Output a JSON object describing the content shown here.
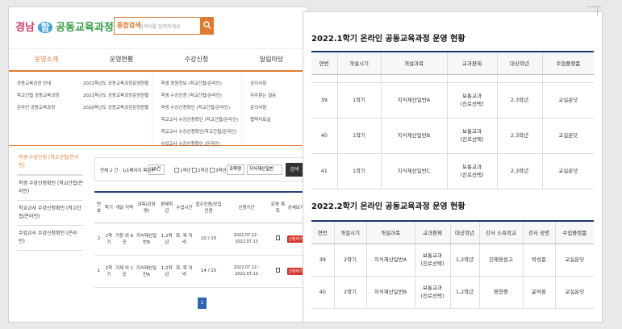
{
  "site": {
    "logo": {
      "part1": "경남",
      "part2": "함",
      "part3": "공동교육과정"
    },
    "search_tag": "통합검색",
    "search_placeholder": "검색어를 입력하세요",
    "gnb": [
      "운영소개",
      "운영현황",
      "수강신청",
      "알림마당"
    ],
    "mega": [
      [
        "공동교육과정 안내",
        "학교간협 공동교육과정",
        "온라인 공동교육과정"
      ],
      [
        "2022학년도 공동교육과정운영현황",
        "2021학년도 공동교육과정운영현황",
        "2020학년도 공동교육과정운영현황"
      ],
      [
        "학생 회원정보 (학교간협/온라인)",
        "학생 수강신청 (학교간협/온라인)",
        "학생 수강신청확인 (학교간협/온라인)",
        "학교교사 수강신청확인 (학교간협/온라인)",
        "학교교사 수강신청확인(학교간협/온라인)",
        "수업교사 수강신청확인 (온라인)"
      ],
      [
        "공지사항",
        "자주묻는 질문",
        "문의사항",
        "협력자료실"
      ]
    ],
    "lnb": [
      "학생 수강신청 (학교간협/온라인)",
      "학생 수강신청확인 (학교간협/온라인)",
      "학교교사 수강신청확인 (학교간협/온라인)",
      "수업교사 수강신청확인 (온라인)"
    ],
    "filter": {
      "count": "전체 2 건 · 1/1페이지 목록수",
      "per_page": "10건",
      "chk1": "1학년",
      "chk2": "2학년",
      "chk3": "3학년",
      "subject_select": "과목명",
      "keyword": "지식재산일반",
      "search_btn": "검색"
    },
    "course_table": {
      "headers": [
        "번호",
        "학기",
        "개설 지역",
        "과목(강좌명)",
        "편제학년",
        "수업시간",
        "접수인원/모집인원",
        "신청기간",
        "운영 계획",
        "상세보기"
      ],
      "rows": [
        [
          "2",
          "2학기",
          "거창 외 6곳",
          "지식재산일반B",
          "1,2학년",
          "화, 목 저녁",
          "10 / 15",
          "2022.07.12 - 2022.07.13",
          "신청하기"
        ],
        [
          "1",
          "2학기",
          "거제 외 1곳",
          "지식재산일반A",
          "1,2학년",
          "화, 목 저녁",
          "14 / 15",
          "2022.07.12 - 2022.07.13",
          "신청하기"
        ]
      ]
    },
    "page_num": "1"
  },
  "doc": {
    "title1": "2022.1학기 온라인 공동교육과정 운영 현황",
    "table1": {
      "headers": [
        "연번",
        "개설시기",
        "개설과목",
        "교과편제",
        "대상학년",
        "수업플랫폼"
      ],
      "rows": [
        [
          "39",
          "1학기",
          "지식재산일반A",
          "보통교과\n(진로선택)",
          "2,3학년",
          "교실온닷"
        ],
        [
          "40",
          "1학기",
          "지식재산일반B",
          "보통교과\n(진로선택)",
          "2,3학년",
          "교실온닷"
        ],
        [
          "41",
          "1학기",
          "지식재산일반C",
          "보통교과\n(진로선택)",
          "2,3학년",
          "교실온닷"
        ]
      ]
    },
    "title2": "2022.2학기 온라인 공동교육과정 운영 현황",
    "table2": {
      "headers": [
        "연번",
        "개설시기",
        "개설과목",
        "교과편제",
        "대상학년",
        "강사 소속학교",
        "강사 성명",
        "수업플랫폼"
      ],
      "rows": [
        [
          "39",
          "2학기",
          "지식재산일반A",
          "보통교과\n(진로선택)",
          "1,2학년",
          "진해용원고",
          "박성준",
          "교실온닷"
        ],
        [
          "40",
          "2학기",
          "지식재산일반B",
          "보통교과\n(진로선택)",
          "1,2학년",
          "용현중",
          "윤익환",
          "교실온닷"
        ]
      ]
    }
  },
  "colors": {
    "accent": "#e07a2e",
    "navy": "#1d3570",
    "apply": "#d9342b",
    "pager": "#2d63b4"
  }
}
